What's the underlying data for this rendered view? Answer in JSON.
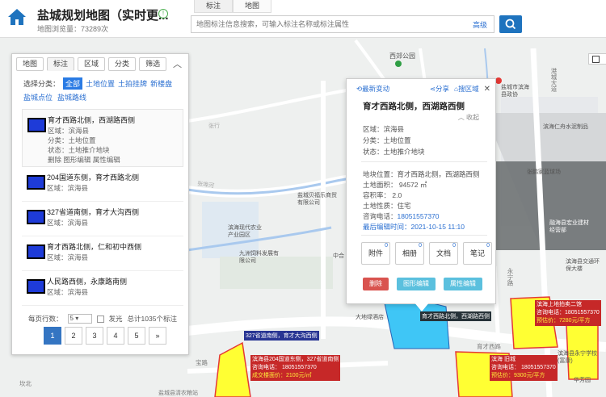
{
  "header": {
    "title": "盐城规划地图（实时更...",
    "views": "地图浏览量：73289次",
    "tabs": [
      "标注",
      "地图"
    ]
  },
  "search": {
    "placeholder": "地图标注信息搜索，可输入标注名称或标注属性",
    "advanced": "高级"
  },
  "panel": {
    "tabs": [
      "地图",
      "标注",
      "区域",
      "分类",
      "筛选"
    ],
    "collapse": "︿",
    "category_label": "选择分类：",
    "categories": [
      "全部",
      "土地位置",
      "土拍挂牌",
      "新楼盘"
    ],
    "categories2": [
      "盐城点位",
      "盐城路线"
    ],
    "items": [
      {
        "title": "育才西路北侧，西湖路西侧",
        "area": "区域：滨海县",
        "category": "分类：土地位置",
        "status": "状态：土地推介地块",
        "actions": "删除  图形编辑  属性编辑"
      },
      {
        "title": "204国道东侧，育才西路北侧",
        "area": "区域：滨海县"
      },
      {
        "title": "327省道南侧，育才大沟西侧",
        "area": "区域：滨海县"
      },
      {
        "title": "育才西路北侧，仁和初中西侧",
        "area": "区域：滨海县"
      },
      {
        "title": "人民路西侧，永康路南侧",
        "area": "区域：滨海县"
      }
    ],
    "pager": {
      "rows_label": "每页行数：",
      "rows_value": "5",
      "glow_label": "发光",
      "total": "总计1035个标注",
      "pages": [
        "1",
        "2",
        "3",
        "4",
        "5",
        "»"
      ]
    }
  },
  "popup": {
    "recent": "最新变动",
    "share": "分享",
    "search_area": "搜区域",
    "close": "✕",
    "title": "育才西路北侧，西湖路西侧",
    "collapse": "收起",
    "area": "区域：滨海县",
    "category": "分类：土地位置",
    "status": "状态：土地推介地块",
    "location": "地块位置：育才西路北侧，西湖路西侧",
    "land_area": "土地面积： 94572 ㎡",
    "far": "容积率： 2.0",
    "usage": "土地性质：住宅",
    "phone_label": "咨询电话：",
    "phone": "18051557370",
    "last_edit": "最后编辑时间：2021-10-15 11:10",
    "attachments": [
      {
        "label": "附件",
        "count": "0"
      },
      {
        "label": "相册",
        "count": "0"
      },
      {
        "label": "文档",
        "count": "0"
      },
      {
        "label": "笔记",
        "count": "0"
      }
    ],
    "actions": [
      "删除",
      "图形编辑",
      "属性编辑"
    ]
  },
  "map": {
    "labels": [
      "西郊公园",
      "盐城市滨海县政协",
      "盐城市坎...",
      "张行",
      "滨海仁舟水泥制品",
      "张鹏家蓝球场",
      "盐城贝福乐商贸有限公司",
      "滨海现代农业产业园区",
      "九洲饲料发展有限公司",
      "中合",
      "融海县宏业建材经营部",
      "永宁路",
      "滨海县交通环保大楼",
      "滨海县永宁学校(富康)",
      "华芳园",
      "大地绿酒店",
      "育才西路",
      "坎北",
      "盐城县清农粮站",
      "保鲜"
    ],
    "roads": [
      "育才西路",
      "港城大道",
      "永宁路",
      "宝路",
      "张埠河"
    ],
    "markers": {
      "selected_label": "育才西路北侧，西湖路西侧",
      "m327": "327省道南侧，育才大沟西侧",
      "m204_a": "滨海县204国道东侧，327省道南侧",
      "m204_phone": "咨询电话： 18051557370",
      "m204_price": "成交楼面价：2100元/㎡",
      "mid_title": "滨海 旧城",
      "mid_phone": "咨询电话： 18051557370",
      "mid_price": "预估价：9300元/平方",
      "right_title": "滨海上地拍卖二馆",
      "right_phone": "咨询电话：18051557370",
      "right_price": "预估价：7280元/平方"
    },
    "check_label": " "
  },
  "colors": {
    "accent": "#2a7be4",
    "plot_yellow": "#ffff33",
    "plot_red": "#e53935"
  }
}
